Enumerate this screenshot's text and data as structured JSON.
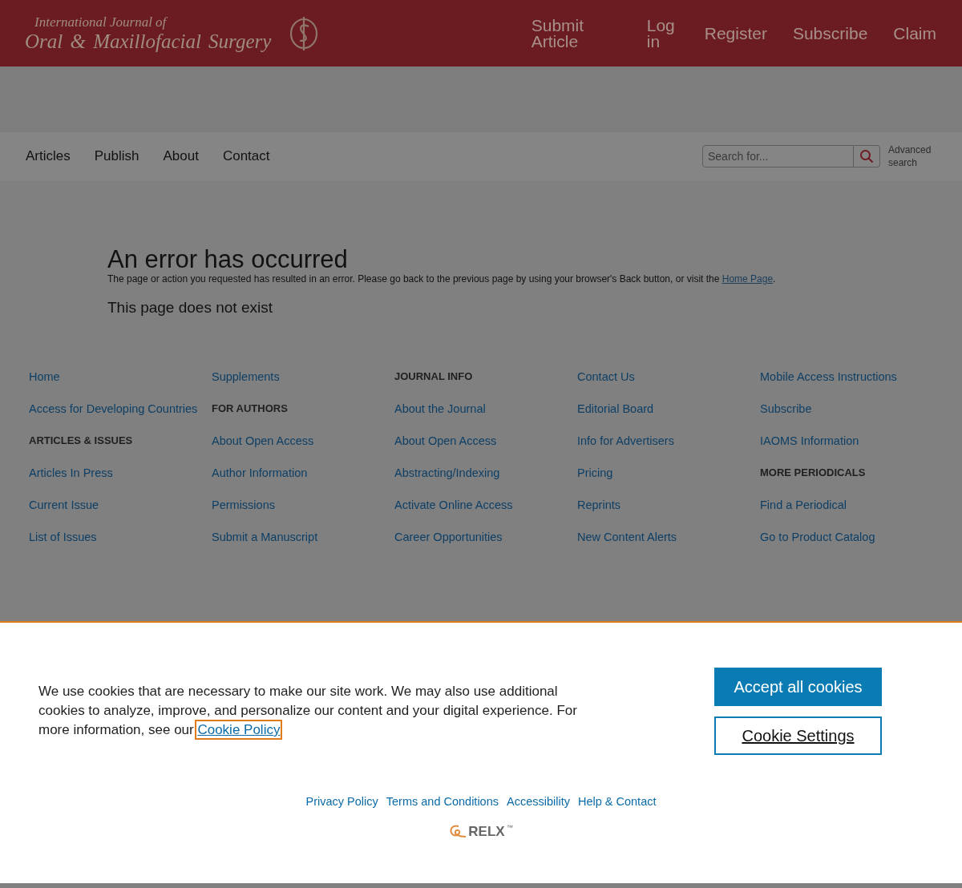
{
  "header": {
    "logo": {
      "line_1": "International Journal of",
      "line_2": "Oral & Maxillofacial Surgery"
    },
    "links": [
      "Submit Article",
      "Log in",
      "Register",
      "Subscribe",
      "Claim"
    ]
  },
  "nav": {
    "items": [
      "Articles",
      "Publish",
      "About",
      "Contact"
    ],
    "search": {
      "placeholder": "Search for..."
    },
    "advanced_search": "Advanced search"
  },
  "error": {
    "title": "An error has occurred",
    "message": "The page or action you requested has resulted in an error. Please go back to the previous page by using your browser's Back button, or visit the ",
    "link": "Home Page",
    "message_end": ".",
    "subtitle": "This page does not exist"
  },
  "footer_columns": [
    [
      {
        "kind": "link",
        "text": "Home"
      },
      {
        "kind": "link",
        "text": "Access for Developing Countries"
      },
      {
        "kind": "heading",
        "text": "ARTICLES & ISSUES"
      },
      {
        "kind": "link",
        "text": "Articles In Press"
      },
      {
        "kind": "link",
        "text": "Current Issue"
      },
      {
        "kind": "link",
        "text": "List of Issues"
      }
    ],
    [
      {
        "kind": "link",
        "text": "Supplements"
      },
      {
        "kind": "heading",
        "text": "FOR AUTHORS"
      },
      {
        "kind": "link",
        "text": "About Open Access"
      },
      {
        "kind": "link",
        "text": "Author Information"
      },
      {
        "kind": "link",
        "text": "Permissions"
      },
      {
        "kind": "link",
        "text": "Submit a Manuscript"
      }
    ],
    [
      {
        "kind": "heading",
        "text": "JOURNAL INFO"
      },
      {
        "kind": "link",
        "text": "About the Journal"
      },
      {
        "kind": "link",
        "text": "About Open Access"
      },
      {
        "kind": "link",
        "text": "Abstracting/Indexing"
      },
      {
        "kind": "link",
        "text": "Activate Online Access"
      },
      {
        "kind": "link",
        "text": "Career Opportunities"
      }
    ],
    [
      {
        "kind": "link",
        "text": "Contact Us"
      },
      {
        "kind": "link",
        "text": "Editorial Board"
      },
      {
        "kind": "link",
        "text": "Info for Advertisers"
      },
      {
        "kind": "link",
        "text": "Pricing"
      },
      {
        "kind": "link",
        "text": "Reprints"
      },
      {
        "kind": "link",
        "text": "New Content Alerts"
      }
    ],
    [
      {
        "kind": "link",
        "text": "Mobile Access Instructions"
      },
      {
        "kind": "link",
        "text": "Subscribe"
      },
      {
        "kind": "link",
        "text": "IAOMS Information"
      },
      {
        "kind": "heading",
        "text": "MORE PERIODICALS"
      },
      {
        "kind": "link",
        "text": "Find a Periodical"
      },
      {
        "kind": "link",
        "text": "Go to Product Catalog"
      }
    ]
  ],
  "cookie_banner": {
    "text": "We use cookies that are necessary to make our site work. We may also use additional cookies to analyze, improve, and personalize our content and your digital experience. For more information, see our ",
    "policy_link": "Cookie Policy",
    "accept_button": "Accept all cookies",
    "settings_button": "Cookie Settings",
    "links": [
      "Privacy Policy",
      "Terms and Conditions",
      "Accessibility",
      "Help & Contact"
    ],
    "relx": {
      "name": "RELX",
      "mark": "™"
    }
  }
}
